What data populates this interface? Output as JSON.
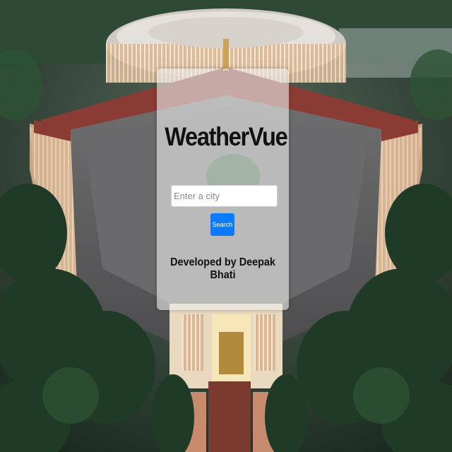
{
  "app": {
    "title": "WeatherVue"
  },
  "search": {
    "placeholder": "Enter a city",
    "value": "",
    "button_label": "Search"
  },
  "footer": {
    "credit": "Developed by Deepak Bhati"
  },
  "colors": {
    "accent": "#0b7cff",
    "card_background": "#ebebeb"
  }
}
